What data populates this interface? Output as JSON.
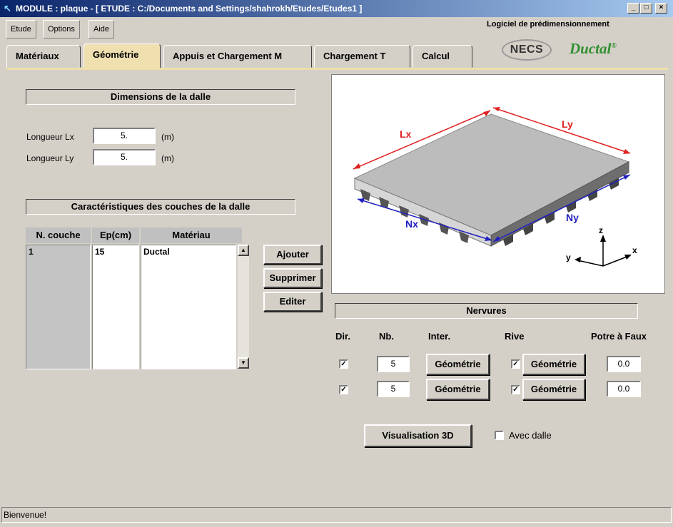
{
  "window": {
    "title": "MODULE : plaque  -  [ ETUDE : C:/Documents and Settings/shahrokh/Etudes/Etudes1 ]",
    "minimize": "_",
    "maximize": "□",
    "close": "×"
  },
  "menu": {
    "etude": "Etude",
    "options": "Options",
    "aide": "Aide"
  },
  "brand": {
    "tagline": "Logiciel de prédimensionnement",
    "necs": "NECS",
    "ductal": "Ductal",
    "ductal_mark": "®"
  },
  "tabs": [
    {
      "label": "Matériaux"
    },
    {
      "label": "Géométrie"
    },
    {
      "label": "Appuis et Chargement M"
    },
    {
      "label": "Chargement T"
    },
    {
      "label": "Calcul"
    }
  ],
  "dimensions": {
    "title": "Dimensions de la dalle",
    "lx_label": "Longueur Lx",
    "lx_value": "5.",
    "ly_label": "Longueur Ly",
    "ly_value": "5.",
    "unit": "(m)"
  },
  "layers": {
    "title": "Caractéristiques des couches de la dalle",
    "headers": {
      "n": "N. couche",
      "ep": "Ep(cm)",
      "mat": "Matériau"
    },
    "rows": [
      {
        "n": "1",
        "ep": "15",
        "mat": "Ductal"
      }
    ],
    "buttons": {
      "add": "Ajouter",
      "delete": "Supprimer",
      "edit": "Editer"
    }
  },
  "diagram": {
    "lx": "Lx",
    "ly": "Ly",
    "nx": "Nx",
    "ny": "Ny",
    "axis_x": "x",
    "axis_y": "y",
    "axis_z": "z"
  },
  "nervures": {
    "title": "Nervures",
    "headers": {
      "dir": "Dir.",
      "nb": "Nb.",
      "inter": "Inter.",
      "rive": "Rive",
      "potre": "Potre à Faux"
    },
    "rows": [
      {
        "dir_checked": true,
        "nb": "5",
        "inter_btn": "Géométrie",
        "rive_checked": true,
        "rive_btn": "Géométrie",
        "potre": "0.0"
      },
      {
        "dir_checked": true,
        "nb": "5",
        "inter_btn": "Géométrie",
        "rive_checked": true,
        "rive_btn": "Géométrie",
        "potre": "0.0"
      }
    ]
  },
  "viz": {
    "button": "Visualisation 3D",
    "avec_dalle": "Avec dalle"
  },
  "status": {
    "text": "Bienvenue!"
  },
  "colors": {
    "tab_active": "#f0e0b0",
    "title_start": "#0a246a",
    "title_end": "#a6caf0",
    "ductal_green": "#2f8f2f"
  }
}
